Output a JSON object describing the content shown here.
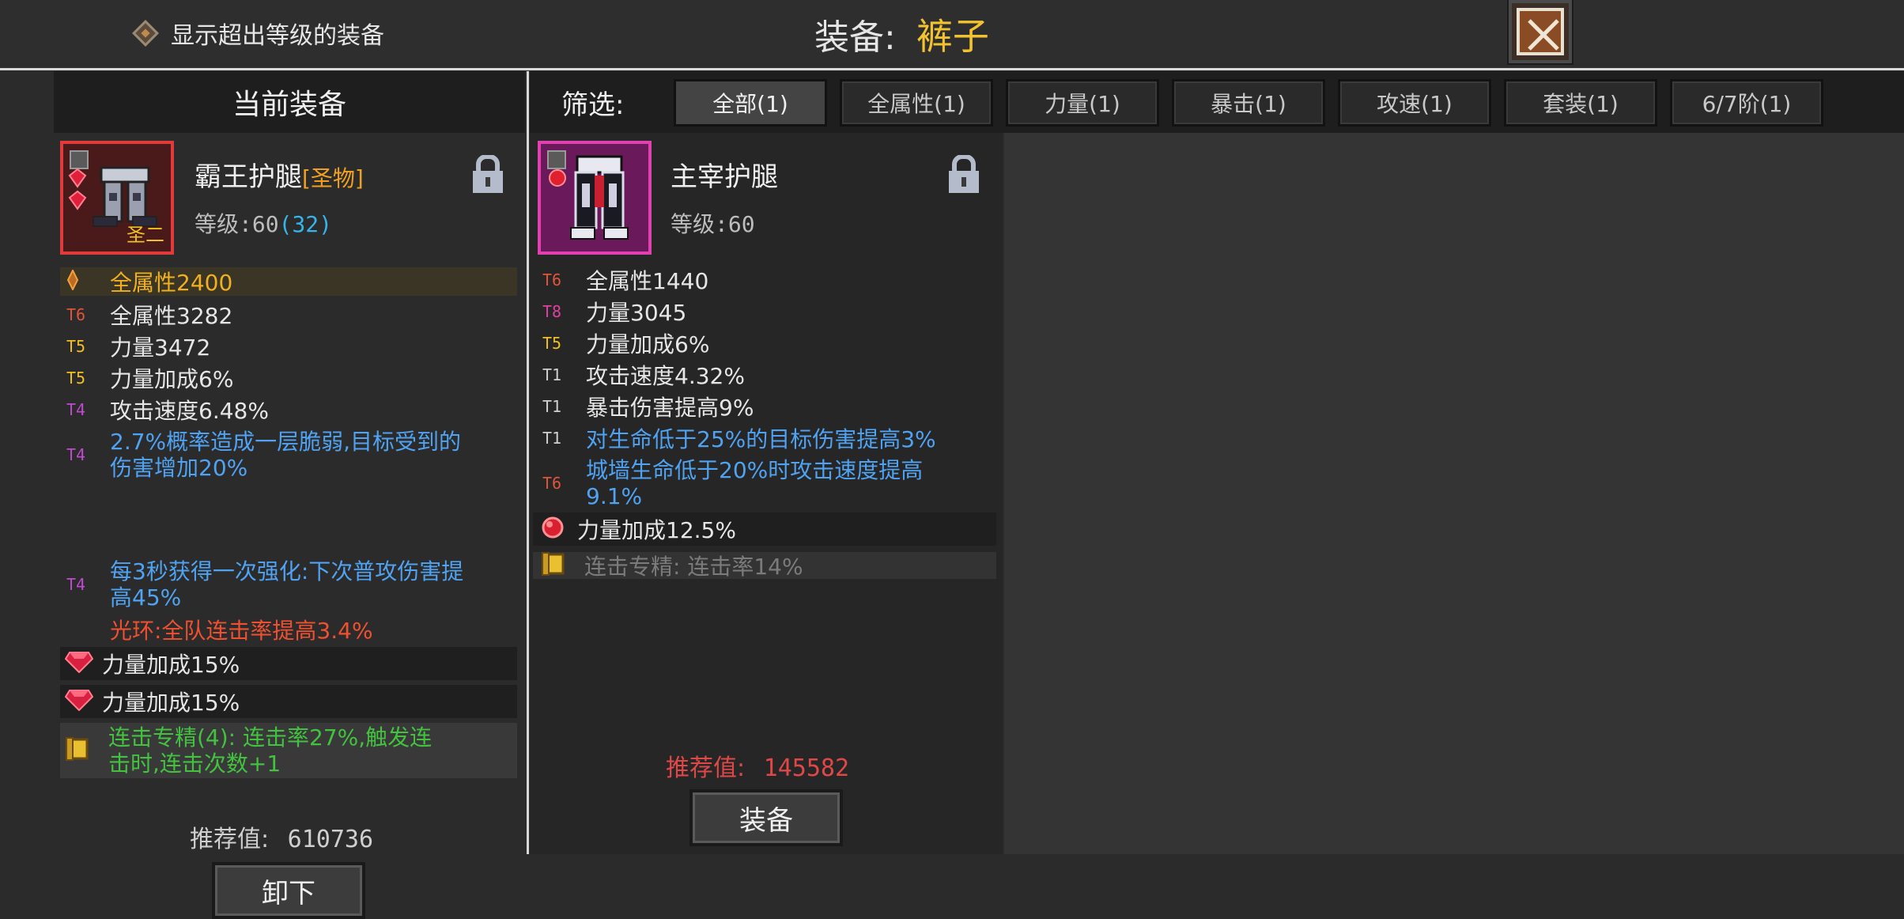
{
  "top_bar": {
    "show_toggle_label": "显示超出等级的装备",
    "title_prefix": "装备:",
    "title_value": "裤子",
    "close_icon": "close-x-icon"
  },
  "left_panel": {
    "header": "当前装备",
    "item": {
      "name": "霸王护腿",
      "quality": "[圣物]",
      "level_label": "等级:60",
      "level_extra": "(32)",
      "icon_badge": "圣二",
      "locked": true
    },
    "stats": [
      {
        "tier": "",
        "text": "全属性2400",
        "style": "highlight"
      },
      {
        "tier": "T6",
        "text": "全属性3282"
      },
      {
        "tier": "T5",
        "text": "力量3472"
      },
      {
        "tier": "T5",
        "text": "力量加成6%"
      },
      {
        "tier": "T4",
        "text": "攻击速度6.48%"
      },
      {
        "tier": "T4",
        "text": "2.7%概率造成一层脆弱,目标受到的伤害增加20%",
        "lines": [
          "2.7%概率造成一层脆弱,目标受到的",
          "伤害增加20%"
        ]
      },
      {
        "tier": "T4",
        "text": "每3秒获得一次强化:下次普攻伤害提高45%",
        "lines": [
          "每3秒获得一次强化:下次普攻伤害提",
          "高45%"
        ]
      },
      {
        "tier": "",
        "text": "光环:全队连击率提高3.4%"
      }
    ],
    "gems": [
      "力量加成15%",
      "力量加成15%"
    ],
    "set_bonus": {
      "text": "连击专精(4): 连击率27%,触发连击时,连击次数+1",
      "lines": [
        "连击专精(4): 连击率27%,触发连",
        "击时,连击次数+1"
      ]
    },
    "recommend_label": "推荐值:",
    "recommend_value": "610736",
    "action_button": "卸下"
  },
  "filter": {
    "label": "筛选:",
    "tabs": [
      "全部(1)",
      "全属性(1)",
      "力量(1)",
      "暴击(1)",
      "攻速(1)",
      "套装(1)",
      "6/7阶(1)"
    ],
    "active_index": 0
  },
  "candidate": {
    "item": {
      "name": "主宰护腿",
      "level_label": "等级:60",
      "locked": true
    },
    "stats": [
      {
        "tier": "T6",
        "text": "全属性1440"
      },
      {
        "tier": "T8",
        "text": "力量3045"
      },
      {
        "tier": "T5",
        "text": "力量加成6%"
      },
      {
        "tier": "T1",
        "text": "攻击速度4.32%"
      },
      {
        "tier": "T1",
        "text": "暴击伤害提高9%"
      },
      {
        "tier": "T1",
        "text": "对生命低于25%的目标伤害提高3%"
      },
      {
        "tier": "T6",
        "text": "城墙生命低于20%时攻击速度提高9.1%",
        "lines": [
          "城墙生命低于20%时攻击速度提高",
          "9.1%"
        ]
      }
    ],
    "gem": "力量加成12.5%",
    "set_bonus": "连击专精: 连击率14%",
    "recommend_label": "推荐值:",
    "recommend_value": "145582",
    "action_button": "装备"
  },
  "colors": {
    "gold_title": "#f2c230",
    "tier_t6": "#e0553a",
    "tier_t5": "#f0c020",
    "tier_t4": "#c04ad0",
    "tier_t8": "#e040a0",
    "skill_blue": "#4fa3f2",
    "aura_red": "#f05030",
    "set_green": "#42c23f",
    "recommend_red": "#e04848"
  }
}
